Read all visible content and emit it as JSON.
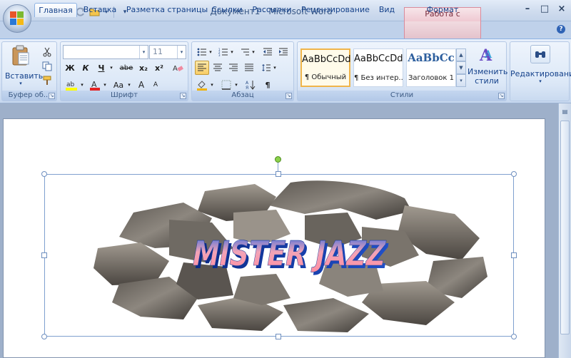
{
  "window": {
    "title": "Документ1 - Microsoft Word",
    "context_group": "Работа с рисунками"
  },
  "tabs": [
    "Главная",
    "Вставка",
    "Разметка страницы",
    "Ссылки",
    "Рассылки",
    "Рецензирование",
    "Вид",
    "Формат"
  ],
  "ribbon": {
    "clipboard": {
      "paste_label": "Вставить",
      "group_label": "Буфер об..."
    },
    "font": {
      "font_name": "",
      "font_size": "11",
      "bold": "Ж",
      "italic": "К",
      "underline": "Ч",
      "strike": "abe",
      "subscript": "x₂",
      "superscript": "x²",
      "case": "Aa",
      "grow": "A",
      "shrink": "A",
      "group_label": "Шрифт"
    },
    "paragraph": {
      "group_label": "Абзац",
      "pilcrow": "¶"
    },
    "styles": {
      "items": [
        {
          "sample": "AaBbCcDd",
          "name": "¶ Обычный"
        },
        {
          "sample": "AaBbCcDd",
          "name": "¶ Без интер..."
        },
        {
          "sample": "AaBbCc",
          "name": "Заголовок 1"
        }
      ],
      "change_styles": "Изменить стили",
      "group_label": "Стили"
    },
    "editing": {
      "label": "Редактирование"
    }
  },
  "document": {
    "wordart_text": "MISTER JAZZ"
  },
  "colors": {
    "accent": "#15428b",
    "context": "#d88b9c",
    "highlight": "#f0b54a"
  }
}
